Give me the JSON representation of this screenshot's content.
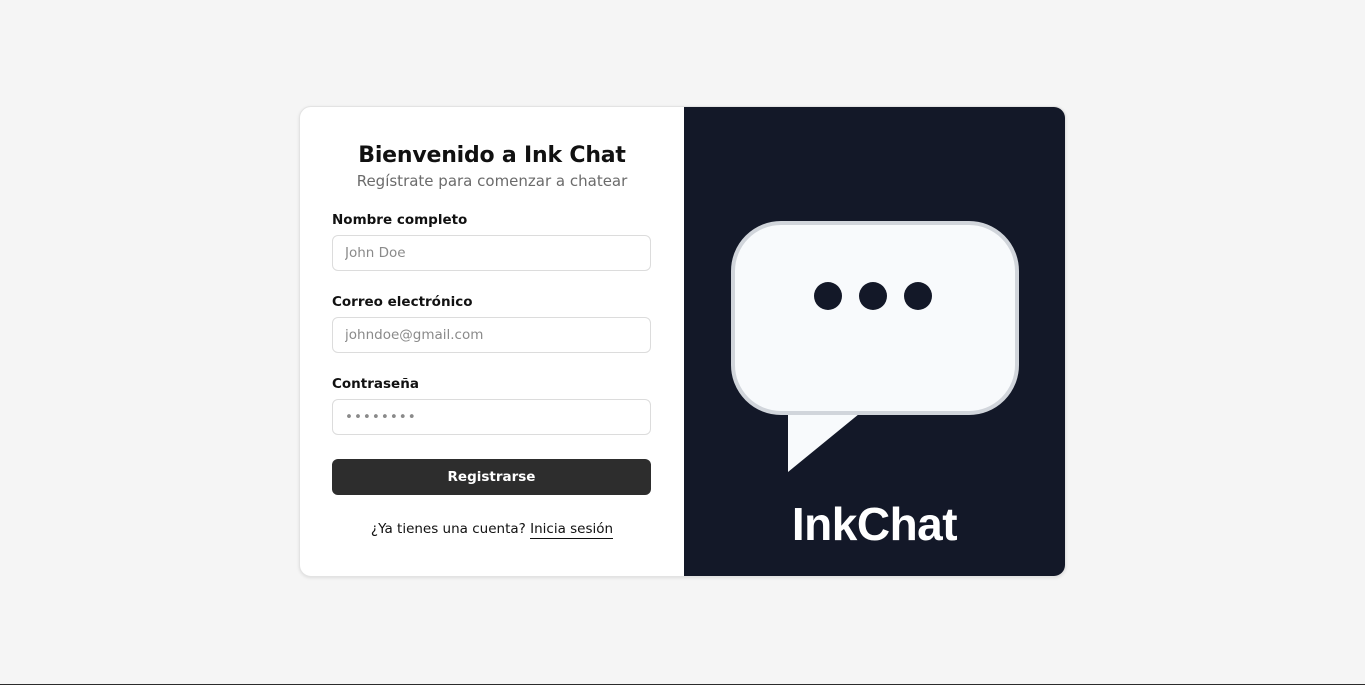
{
  "form": {
    "title": "Bienvenido a Ink Chat",
    "subtitle": "Regístrate para comenzar a chatear",
    "fields": {
      "name": {
        "label": "Nombre completo",
        "placeholder": "John Doe",
        "value": ""
      },
      "email": {
        "label": "Correo electrónico",
        "placeholder": "johndoe@gmail.com",
        "value": ""
      },
      "password": {
        "label": "Contraseña",
        "placeholder": "••••••••",
        "value": ""
      }
    },
    "submit_label": "Registrarse",
    "login_prompt": "¿Ya tienes una cuenta?",
    "login_link": "Inicia sesión"
  },
  "brand": {
    "name": "InkChat",
    "logo_icon": "chat-bubble-typing-icon",
    "background_color": "#131828",
    "bubble_color": "#f8fafc",
    "bubble_border_color": "#d1d5db"
  },
  "colors": {
    "page_background": "#f5f5f5",
    "button_background": "#2d2d2d"
  }
}
